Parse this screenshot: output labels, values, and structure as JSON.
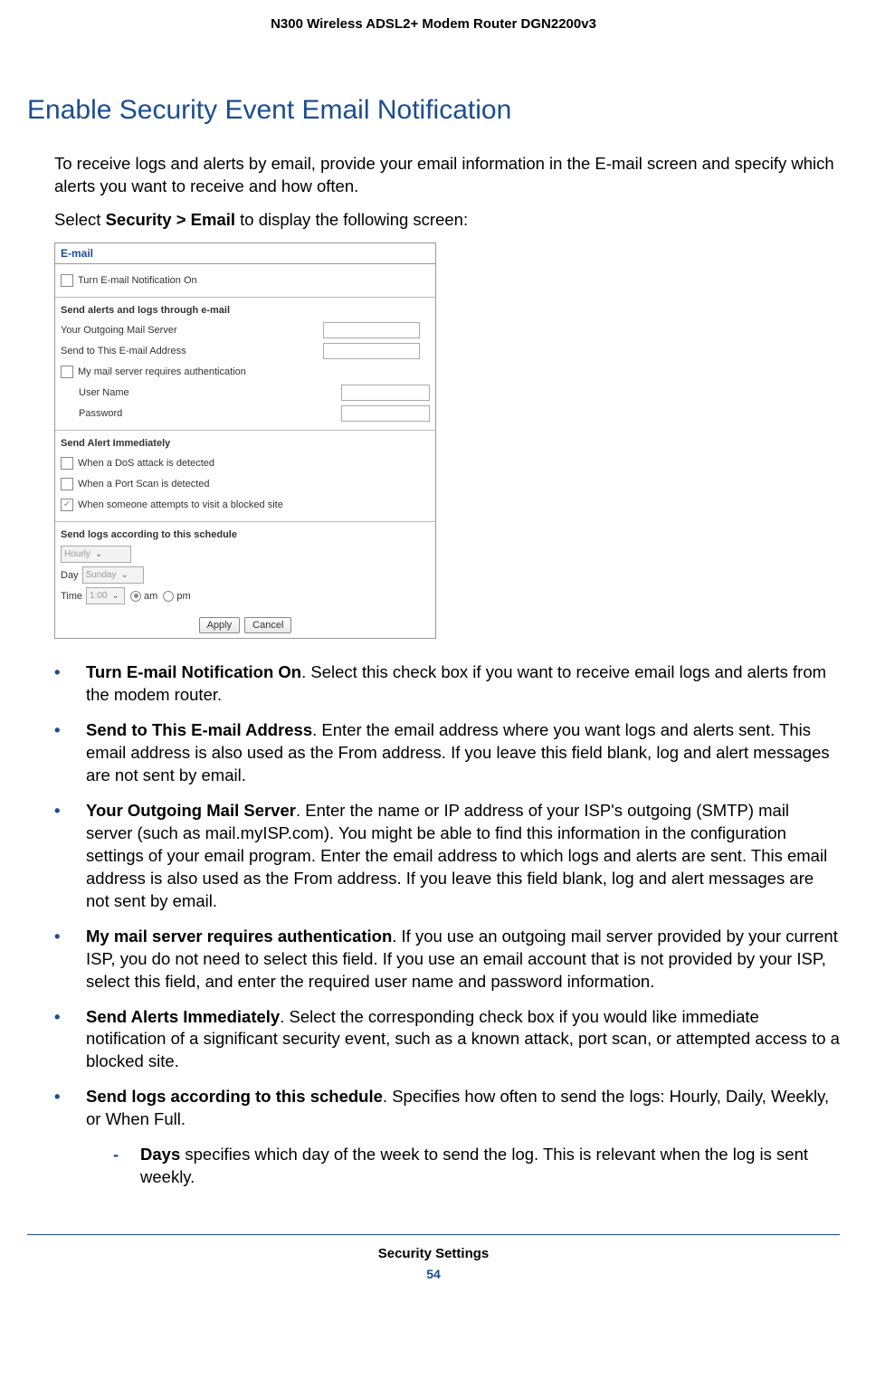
{
  "header": {
    "title": "N300 Wireless ADSL2+ Modem Router DGN2200v3"
  },
  "section": {
    "heading": "Enable Security Event Email Notification",
    "intro1": "To receive logs and alerts by email, provide your email information in the E-mail screen and specify which alerts you want to receive and how often.",
    "intro2_pre": "Select ",
    "intro2_bold": "Security > Email",
    "intro2_post": " to display the following screen:"
  },
  "screenshot": {
    "title": "E-mail",
    "turn_on_label": "Turn E-mail Notification On",
    "send_through_heading": "Send alerts and logs through e-mail",
    "outgoing_label": "Your Outgoing Mail Server",
    "send_to_label": "Send to This E-mail Address",
    "auth_label": "My mail server requires authentication",
    "username_label": "User Name",
    "password_label": "Password",
    "alert_heading": "Send Alert Immediately",
    "alert_dos": "When a DoS attack is detected",
    "alert_portscan": "When a Port Scan is detected",
    "alert_blocked": "When someone attempts to visit a blocked site",
    "schedule_heading": "Send logs according to this schedule",
    "schedule_value": "Hourly",
    "day_label": "Day",
    "day_value": "Sunday",
    "time_label": "Time",
    "time_value": "1:00",
    "am_label": "am",
    "pm_label": "pm",
    "apply_btn": "Apply",
    "cancel_btn": "Cancel"
  },
  "bullets": {
    "b1_bold": "Turn E-mail Notification On",
    "b1_text": ". Select this check box if you want to receive email logs and alerts from the modem router.",
    "b2_bold": "Send to This E-mail Address",
    "b2_text": ". Enter the email address where you want logs and alerts sent. This email address is also used as the From address. If you leave this field blank, log and alert messages are not sent by email.",
    "b3_bold": "Your Outgoing Mail Server",
    "b3_text": ". Enter the name or IP address of your ISP's outgoing (SMTP) mail server (such as mail.myISP.com). You might be able to find this information in the configuration settings of your email program. Enter the email address to which logs and alerts are sent. This email address is also used as the From address. If you leave this field blank, log and alert messages are not sent by email.",
    "b4_bold": "My mail server requires authentication",
    "b4_text": ". If you use an outgoing mail server provided by your current ISP, you do not need to select this field. If you use an email account that is not provided by your ISP, select this field, and enter the required user name and password information.",
    "b5_bold": "Send Alerts Immediately",
    "b5_text": ". Select the corresponding check box if you would like immediate notification of a significant security event, such as a known attack, port scan, or attempted access to a blocked site.",
    "b6_bold": "Send logs according to this schedule",
    "b6_text": ". Specifies how often to send the logs: Hourly, Daily, Weekly, or When Full.",
    "s1_bold": "Days",
    "s1_text": " specifies which day of the week to send the log. This is relevant when the log is sent weekly."
  },
  "footer": {
    "title": "Security Settings",
    "page": "54"
  }
}
